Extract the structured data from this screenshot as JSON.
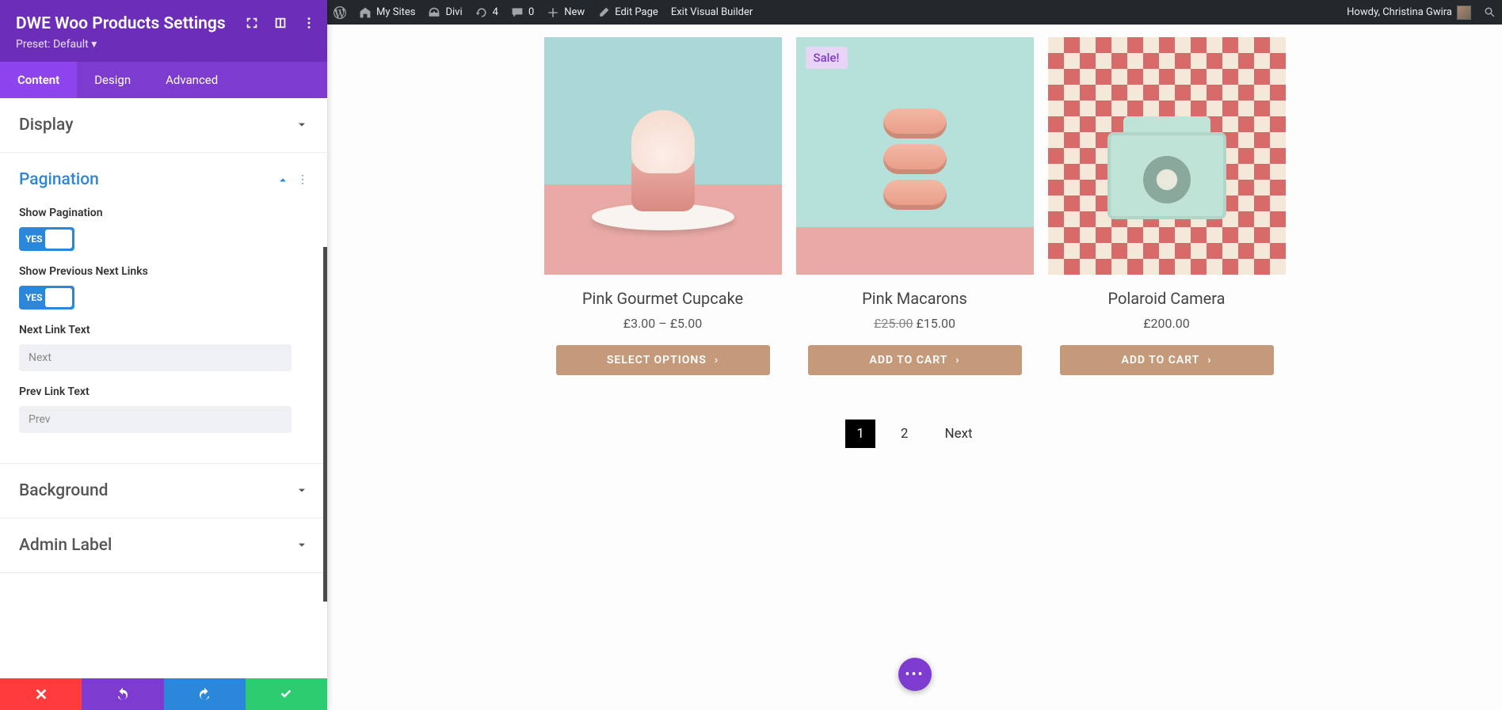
{
  "adminbar": {
    "mysites": "My Sites",
    "divi": "Divi",
    "updates": "4",
    "comments": "0",
    "new": "New",
    "edit": "Edit Page",
    "exit": "Exit Visual Builder",
    "howdy": "Howdy, Christina Gwira"
  },
  "panel": {
    "title": "DWE Woo Products Settings",
    "preset": "Preset: Default ▾",
    "tabs": {
      "content": "Content",
      "design": "Design",
      "advanced": "Advanced"
    },
    "sections": {
      "display": "Display",
      "pagination": "Pagination",
      "background": "Background",
      "admin_label": "Admin Label"
    },
    "fields": {
      "show_pagination": "Show Pagination",
      "show_prev_next": "Show Previous Next Links",
      "next_link_text": "Next Link Text",
      "prev_link_text": "Prev Link Text",
      "toggle_yes": "YES",
      "placeholder_next": "Next",
      "placeholder_prev": "Prev"
    }
  },
  "products": [
    {
      "title": "Pink Gourmet Cupcake",
      "price": "£3.00 – £5.00",
      "btn": "SELECT OPTIONS",
      "sale": false
    },
    {
      "title": "Pink Macarons",
      "price_old": "£25.00",
      "price": "£15.00",
      "btn": "ADD TO CART",
      "sale": true,
      "sale_label": "Sale!"
    },
    {
      "title": "Polaroid Camera",
      "price": "£200.00",
      "btn": "ADD TO CART",
      "sale": false
    }
  ],
  "pagination": {
    "p1": "1",
    "p2": "2",
    "next": "Next"
  }
}
